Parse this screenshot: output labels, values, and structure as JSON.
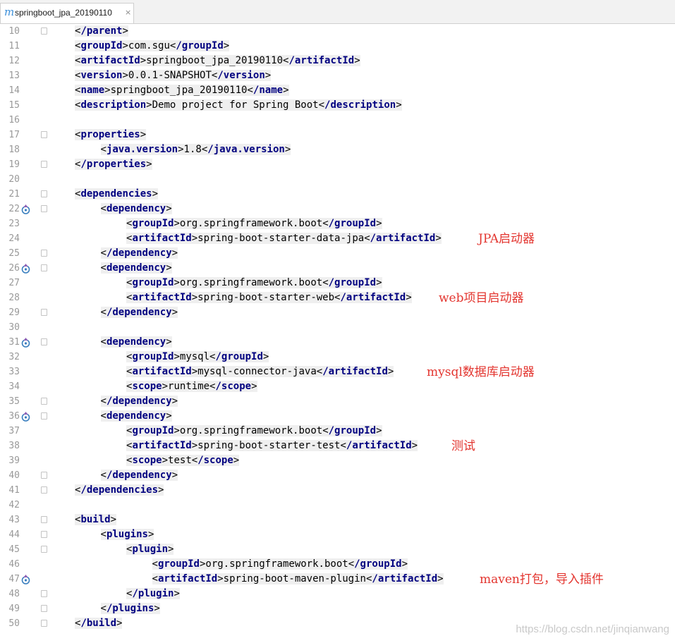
{
  "tab": {
    "icon": "m",
    "title": "springboot_jpa_20190110",
    "close": "×"
  },
  "lines": [
    {
      "n": "10",
      "ind": 1,
      "parts": [
        [
          "<",
          "/parent",
          ">"
        ]
      ],
      "fold": true
    },
    {
      "n": "11",
      "ind": 1,
      "parts": [
        [
          "<",
          "groupId",
          ">"
        ],
        [
          "t",
          "com.sgu"
        ],
        [
          "<",
          "/groupId",
          ">"
        ]
      ]
    },
    {
      "n": "12",
      "ind": 1,
      "parts": [
        [
          "<",
          "artifactId",
          ">"
        ],
        [
          "t",
          "springboot_jpa_20190110"
        ],
        [
          "<",
          "/artifactId",
          ">"
        ]
      ]
    },
    {
      "n": "13",
      "ind": 1,
      "parts": [
        [
          "<",
          "version",
          ">"
        ],
        [
          "t",
          "0.0.1-SNAPSHOT"
        ],
        [
          "<",
          "/version",
          ">"
        ]
      ]
    },
    {
      "n": "14",
      "ind": 1,
      "parts": [
        [
          "<",
          "name",
          ">"
        ],
        [
          "t",
          "springboot_jpa_20190110"
        ],
        [
          "<",
          "/name",
          ">"
        ]
      ]
    },
    {
      "n": "15",
      "ind": 1,
      "parts": [
        [
          "<",
          "description",
          ">"
        ],
        [
          "t",
          "Demo project for Spring Boot"
        ],
        [
          "<",
          "/description",
          ">"
        ]
      ]
    },
    {
      "n": "16",
      "ind": 1,
      "parts": []
    },
    {
      "n": "17",
      "ind": 1,
      "parts": [
        [
          "<",
          "properties",
          ">"
        ]
      ],
      "fold": true
    },
    {
      "n": "18",
      "ind": 2,
      "parts": [
        [
          "<",
          "java.version",
          ">"
        ],
        [
          "t",
          "1.8"
        ],
        [
          "<",
          "/java.version",
          ">"
        ]
      ]
    },
    {
      "n": "19",
      "ind": 1,
      "parts": [
        [
          "<",
          "/properties",
          ">"
        ]
      ],
      "fold": true
    },
    {
      "n": "20",
      "ind": 1,
      "parts": []
    },
    {
      "n": "21",
      "ind": 1,
      "parts": [
        [
          "<",
          "dependencies",
          ">"
        ]
      ],
      "fold": true
    },
    {
      "n": "22",
      "ind": 2,
      "parts": [
        [
          "<",
          "dependency",
          ">"
        ]
      ],
      "fold": true,
      "marker": true
    },
    {
      "n": "23",
      "ind": 3,
      "parts": [
        [
          "<",
          "groupId",
          ">"
        ],
        [
          "t",
          "org.springframework.boot"
        ],
        [
          "<",
          "/groupId",
          ">"
        ]
      ]
    },
    {
      "n": "24",
      "ind": 3,
      "parts": [
        [
          "<",
          "artifactId",
          ">"
        ],
        [
          "t",
          "spring-boot-starter-data-jpa"
        ],
        [
          "<",
          "/artifactId",
          ">"
        ]
      ]
    },
    {
      "n": "25",
      "ind": 2,
      "parts": [
        [
          "<",
          "/dependency",
          ">"
        ]
      ],
      "fold": true
    },
    {
      "n": "26",
      "ind": 2,
      "parts": [
        [
          "<",
          "dependency",
          ">"
        ]
      ],
      "fold": true,
      "marker": true
    },
    {
      "n": "27",
      "ind": 3,
      "parts": [
        [
          "<",
          "groupId",
          ">"
        ],
        [
          "t",
          "org.springframework.boot"
        ],
        [
          "<",
          "/groupId",
          ">"
        ]
      ]
    },
    {
      "n": "28",
      "ind": 3,
      "parts": [
        [
          "<",
          "artifactId",
          ">"
        ],
        [
          "t",
          "spring-boot-starter-web"
        ],
        [
          "<",
          "/artifactId",
          ">"
        ]
      ]
    },
    {
      "n": "29",
      "ind": 2,
      "parts": [
        [
          "<",
          "/dependency",
          ">"
        ]
      ],
      "fold": true
    },
    {
      "n": "30",
      "ind": 2,
      "parts": []
    },
    {
      "n": "31",
      "ind": 2,
      "parts": [
        [
          "<",
          "dependency",
          ">"
        ]
      ],
      "fold": true,
      "marker": true
    },
    {
      "n": "32",
      "ind": 3,
      "parts": [
        [
          "<",
          "groupId",
          ">"
        ],
        [
          "t",
          "mysql"
        ],
        [
          "<",
          "/groupId",
          ">"
        ]
      ]
    },
    {
      "n": "33",
      "ind": 3,
      "parts": [
        [
          "<",
          "artifactId",
          ">"
        ],
        [
          "t",
          "mysql-connector-java"
        ],
        [
          "<",
          "/artifactId",
          ">"
        ]
      ]
    },
    {
      "n": "34",
      "ind": 3,
      "parts": [
        [
          "<",
          "scope",
          ">"
        ],
        [
          "t",
          "runtime"
        ],
        [
          "<",
          "/scope",
          ">"
        ]
      ]
    },
    {
      "n": "35",
      "ind": 2,
      "parts": [
        [
          "<",
          "/dependency",
          ">"
        ]
      ],
      "fold": true
    },
    {
      "n": "36",
      "ind": 2,
      "parts": [
        [
          "<",
          "dependency",
          ">"
        ]
      ],
      "fold": true,
      "marker": true
    },
    {
      "n": "37",
      "ind": 3,
      "parts": [
        [
          "<",
          "groupId",
          ">"
        ],
        [
          "t",
          "org.springframework.boot"
        ],
        [
          "<",
          "/groupId",
          ">"
        ]
      ]
    },
    {
      "n": "38",
      "ind": 3,
      "parts": [
        [
          "<",
          "artifactId",
          ">"
        ],
        [
          "t",
          "spring-boot-starter-test"
        ],
        [
          "<",
          "/artifactId",
          ">"
        ]
      ]
    },
    {
      "n": "39",
      "ind": 3,
      "parts": [
        [
          "<",
          "scope",
          ">"
        ],
        [
          "t",
          "test"
        ],
        [
          "<",
          "/scope",
          ">"
        ]
      ]
    },
    {
      "n": "40",
      "ind": 2,
      "parts": [
        [
          "<",
          "/dependency",
          ">"
        ]
      ],
      "fold": true
    },
    {
      "n": "41",
      "ind": 1,
      "parts": [
        [
          "<",
          "/dependencies",
          ">"
        ]
      ],
      "fold": true
    },
    {
      "n": "42",
      "ind": 1,
      "parts": []
    },
    {
      "n": "43",
      "ind": 1,
      "parts": [
        [
          "<",
          "build",
          ">"
        ]
      ],
      "fold": true
    },
    {
      "n": "44",
      "ind": 2,
      "parts": [
        [
          "<",
          "plugins",
          ">"
        ]
      ],
      "fold": true
    },
    {
      "n": "45",
      "ind": 3,
      "parts": [
        [
          "<",
          "plugin",
          ">"
        ]
      ],
      "fold": true
    },
    {
      "n": "46",
      "ind": 4,
      "parts": [
        [
          "<",
          "groupId",
          ">"
        ],
        [
          "t",
          "org.springframework.boot"
        ],
        [
          "<",
          "/groupId",
          ">"
        ]
      ]
    },
    {
      "n": "47",
      "ind": 4,
      "parts": [
        [
          "<",
          "artifactId",
          ">"
        ],
        [
          "t",
          "spring-boot-maven-plugin"
        ],
        [
          "<",
          "/artifactId",
          ">"
        ]
      ],
      "marker": true
    },
    {
      "n": "48",
      "ind": 3,
      "parts": [
        [
          "<",
          "/plugin",
          ">"
        ]
      ],
      "fold": true
    },
    {
      "n": "49",
      "ind": 2,
      "parts": [
        [
          "<",
          "/plugins",
          ">"
        ]
      ],
      "fold": true
    },
    {
      "n": "50",
      "ind": 1,
      "parts": [
        [
          "<",
          "/build",
          ">"
        ]
      ],
      "fold": true
    }
  ],
  "annotations": [
    {
      "text": "JPA启动器",
      "line": 24,
      "col": 678
    },
    {
      "text": "web项目启动器",
      "line": 28,
      "col": 622
    },
    {
      "text": "mysql数据库启动器",
      "line": 33,
      "col": 605
    },
    {
      "text": "测试",
      "line": 38,
      "col": 640
    },
    {
      "text": "maven打包，导入插件",
      "line": 47,
      "col": 680
    }
  ],
  "watermark": "https://blog.csdn.net/jinqianwang",
  "colors": {
    "tag": "#000080",
    "text": "#000000",
    "annotation": "#e3352f",
    "line_number": "#999999"
  }
}
